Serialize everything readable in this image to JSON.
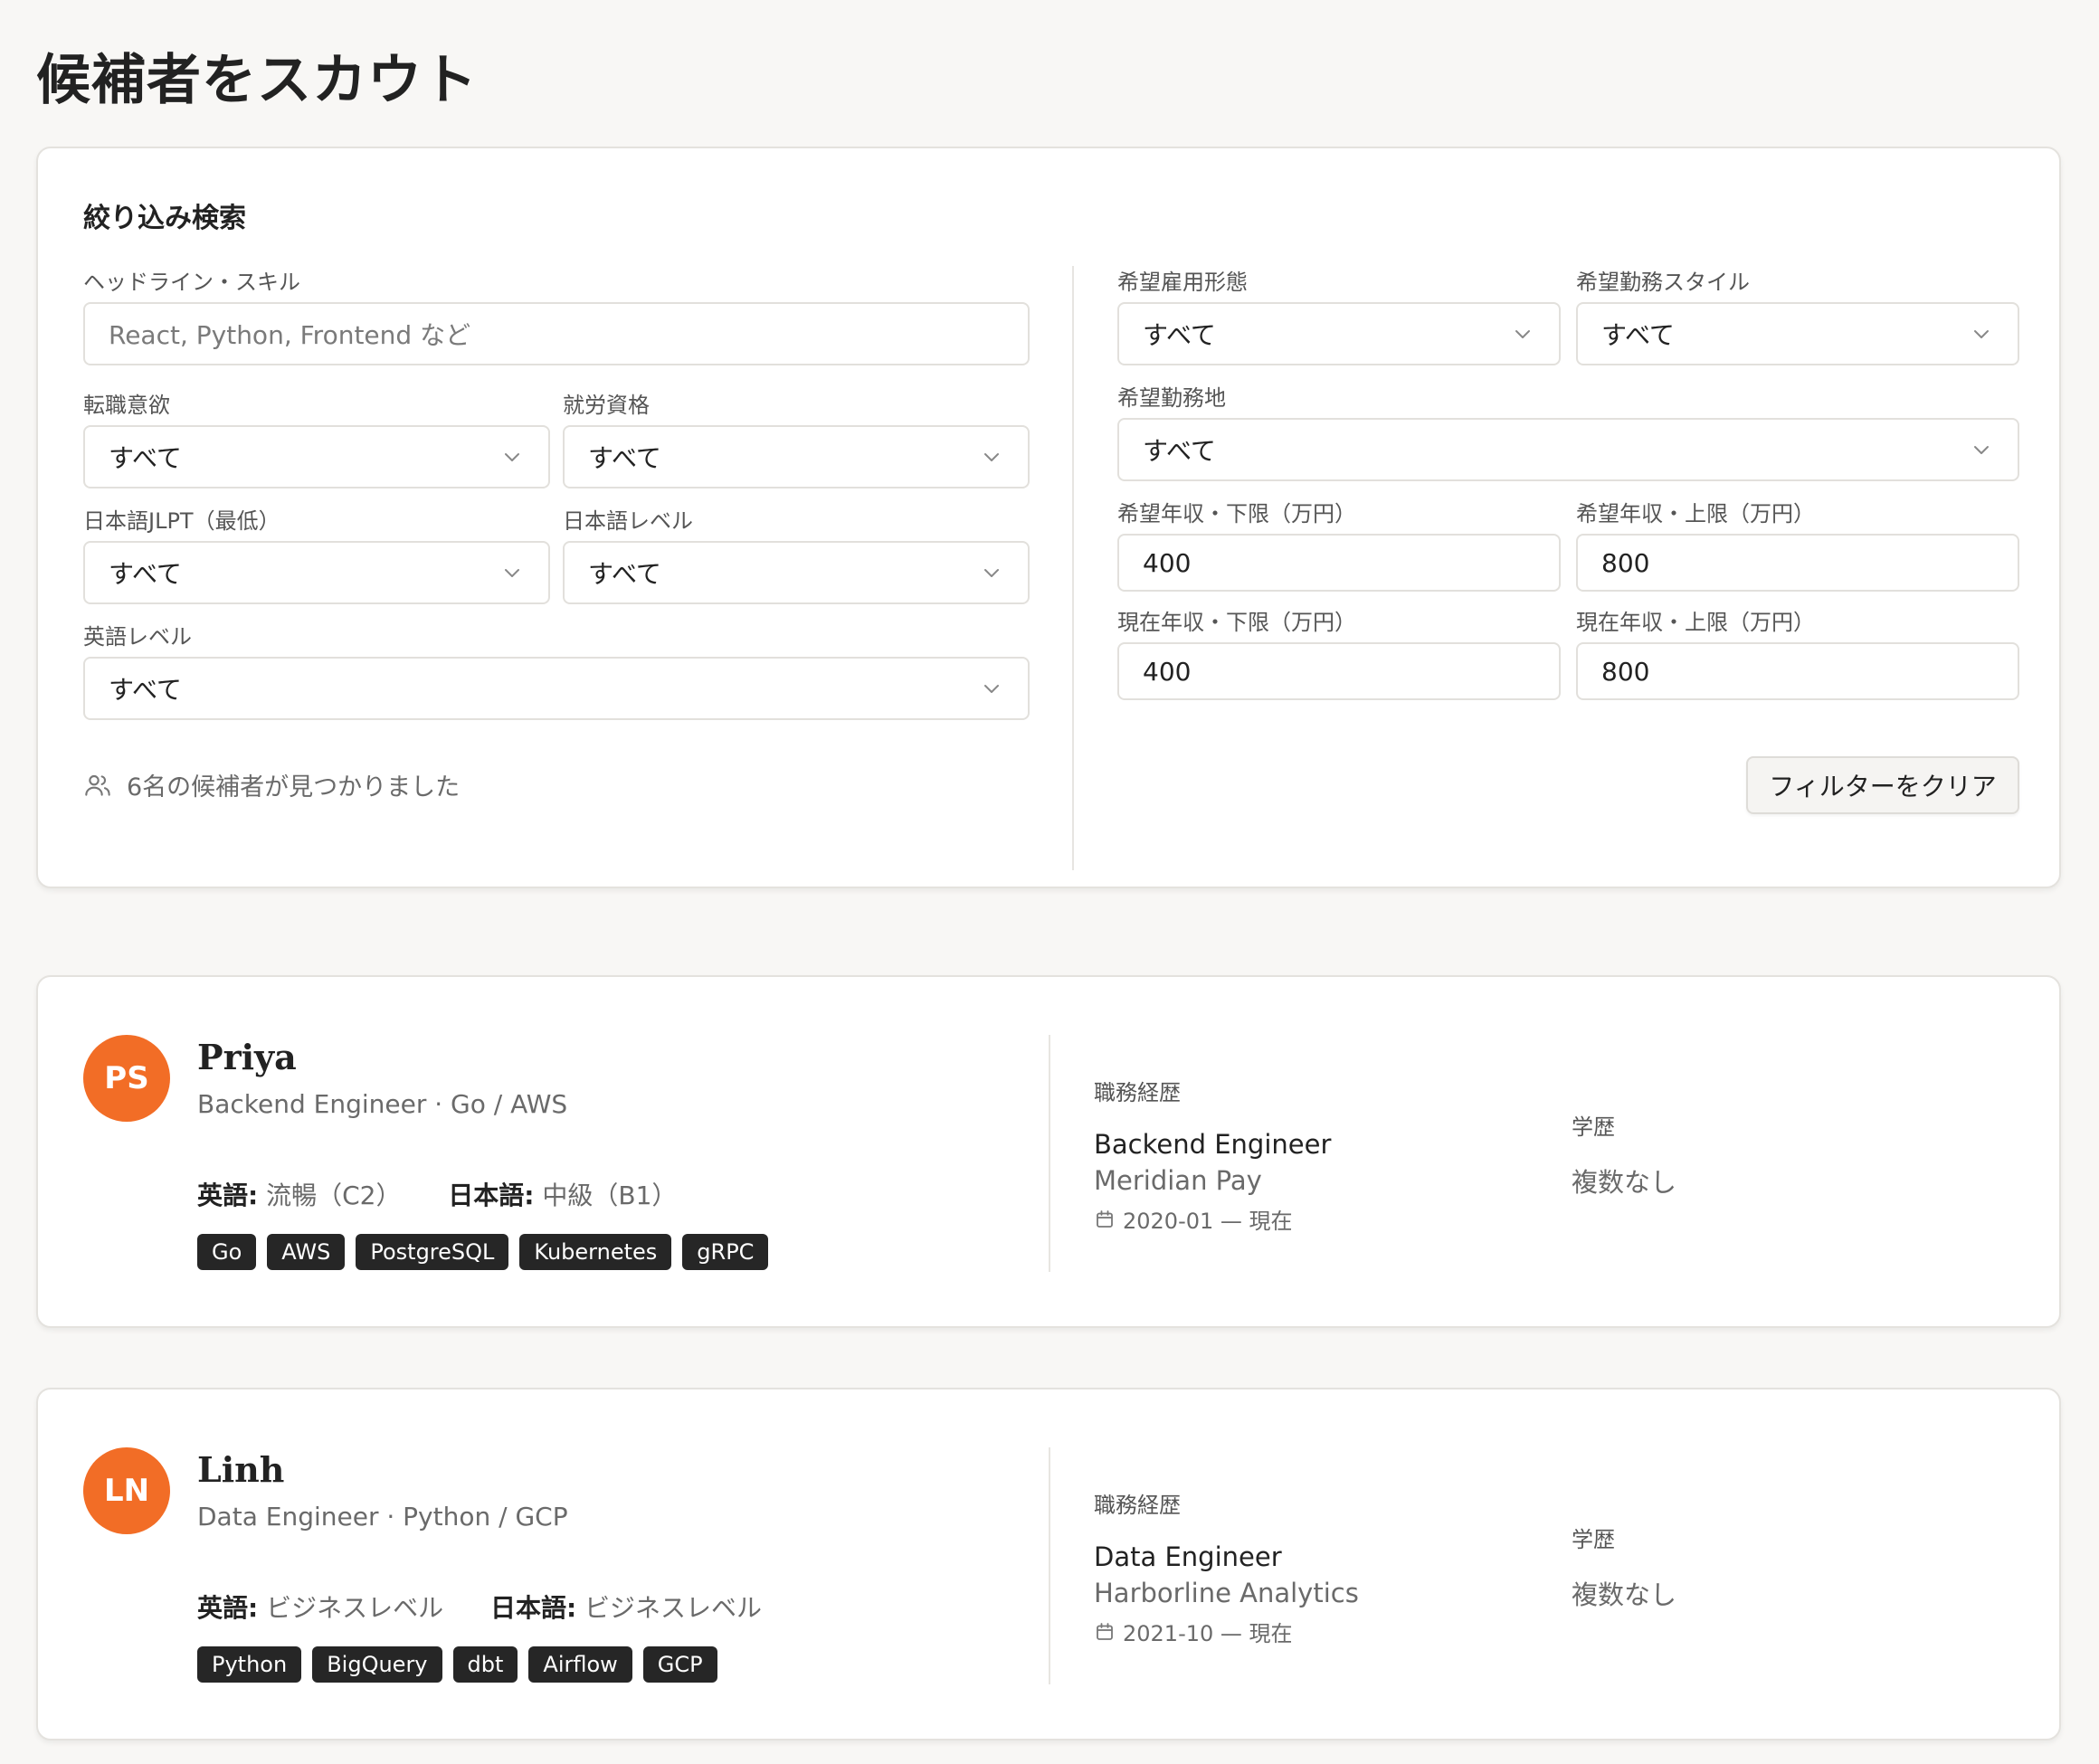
{
  "page_title": "候補者をスカウト",
  "filters": {
    "heading": "絞り込み検索",
    "headline_skill": {
      "label": "ヘッドライン・スキル",
      "placeholder": "React, Python, Frontend など"
    },
    "job_change_intent": {
      "label": "転職意欲",
      "value": "すべて"
    },
    "work_permit": {
      "label": "就労資格",
      "value": "すべて"
    },
    "jlpt_min": {
      "label": "日本語JLPT（最低）",
      "value": "すべて"
    },
    "japanese_level": {
      "label": "日本語レベル",
      "value": "すべて"
    },
    "english_level": {
      "label": "英語レベル",
      "value": "すべて"
    },
    "employment_type": {
      "label": "希望雇用形態",
      "value": "すべて"
    },
    "work_style": {
      "label": "希望勤務スタイル",
      "value": "すべて"
    },
    "work_location": {
      "label": "希望勤務地",
      "value": "すべて"
    },
    "desired_salary_min": {
      "label": "希望年収・下限（万円）",
      "value": "400"
    },
    "desired_salary_max": {
      "label": "希望年収・上限（万円）",
      "value": "800"
    },
    "current_salary_min": {
      "label": "現在年収・下限（万円）",
      "value": "400"
    },
    "current_salary_max": {
      "label": "現在年収・上限（万円）",
      "value": "800"
    },
    "result_count_text": "6名の候補者が見つかりました",
    "clear_button": "フィルターをクリア",
    "icons": {
      "select": "chevron-down-icon",
      "result": "users-icon"
    }
  },
  "candidates": [
    {
      "initials": "PS",
      "name": "Priya",
      "headline": "Backend Engineer · Go / AWS",
      "english_label": "英語:",
      "english_value": "流暢（C2）",
      "japanese_label": "日本語:",
      "japanese_value": "中級（B1）",
      "skills": [
        "Go",
        "AWS",
        "PostgreSQL",
        "Kubernetes",
        "gRPC"
      ],
      "experience_label": "職務経歴",
      "experience_title": "Backend Engineer",
      "experience_company": "Meridian Pay",
      "experience_period": "2020-01 — 現在",
      "education_label": "学歴",
      "education_value": "複数なし"
    },
    {
      "initials": "LN",
      "name": "Linh",
      "headline": "Data Engineer · Python / GCP",
      "english_label": "英語:",
      "english_value": "ビジネスレベル",
      "japanese_label": "日本語:",
      "japanese_value": "ビジネスレベル",
      "skills": [
        "Python",
        "BigQuery",
        "dbt",
        "Airflow",
        "GCP"
      ],
      "experience_label": "職務経歴",
      "experience_title": "Data Engineer",
      "experience_company": "Harborline Analytics",
      "experience_period": "2021-10 — 現在",
      "education_label": "学歴",
      "education_value": "複数なし"
    }
  ],
  "colors": {
    "avatar": "#f26d26",
    "skill_tag": "#262626",
    "background": "#f8f7f5"
  }
}
